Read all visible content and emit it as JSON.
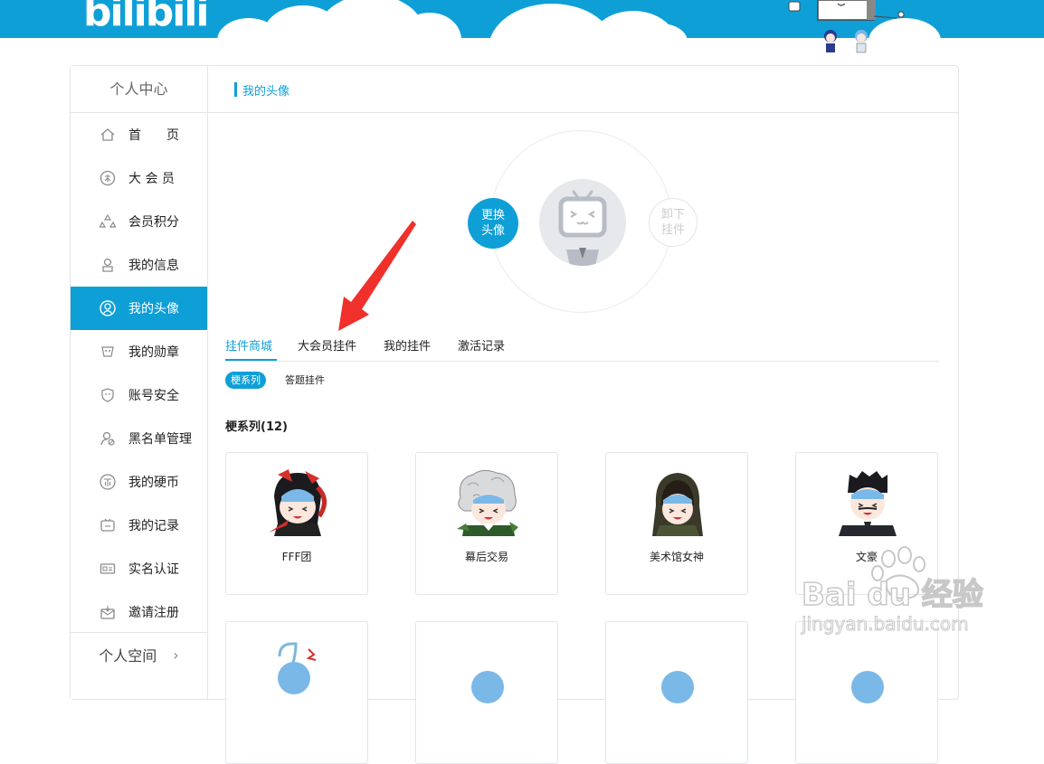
{
  "header": {
    "logo_text": "bilibili",
    "brand_color": "#0e9fd7"
  },
  "sidebar": {
    "title": "个人中心",
    "items": [
      {
        "label": "首　　页",
        "icon": "home-icon",
        "active": false
      },
      {
        "label": "大 会 员",
        "icon": "vip-badge-icon",
        "active": false
      },
      {
        "label": "会员积分",
        "icon": "points-icon",
        "active": false
      },
      {
        "label": "我的信息",
        "icon": "user-info-icon",
        "active": false
      },
      {
        "label": "我的头像",
        "icon": "avatar-icon",
        "active": true
      },
      {
        "label": "我的勋章",
        "icon": "medal-icon",
        "active": false
      },
      {
        "label": "账号安全",
        "icon": "shield-icon",
        "active": false
      },
      {
        "label": "黑名单管理",
        "icon": "blacklist-icon",
        "active": false
      },
      {
        "label": "我的硬币",
        "icon": "coin-icon",
        "active": false
      },
      {
        "label": "我的记录",
        "icon": "record-tv-icon",
        "active": false
      },
      {
        "label": "实名认证",
        "icon": "id-card-icon",
        "active": false
      },
      {
        "label": "邀请注册",
        "icon": "invite-mail-icon",
        "active": false
      }
    ],
    "footer_link": "个人空间"
  },
  "content": {
    "title": "我的头像",
    "change_avatar": "更换\n头像",
    "remove_pendant": "卸下\n挂件",
    "tabs": [
      "挂件商城",
      "大会员挂件",
      "我的挂件",
      "激活记录"
    ],
    "subtabs": [
      "梗系列",
      "答题挂件"
    ],
    "series_title": "梗系列(12)",
    "cards": [
      {
        "name": "FFF团",
        "art": "fff-tuan-pendant-icon"
      },
      {
        "name": "幕后交易",
        "art": "behind-deal-pendant-icon"
      },
      {
        "name": "美术馆女神",
        "art": "museum-goddess-pendant-icon"
      },
      {
        "name": "文豪",
        "art": "literary-master-pendant-icon"
      }
    ]
  },
  "watermark": {
    "text": "Bai du 经验",
    "url_text": "jingyan.baidu.com"
  }
}
